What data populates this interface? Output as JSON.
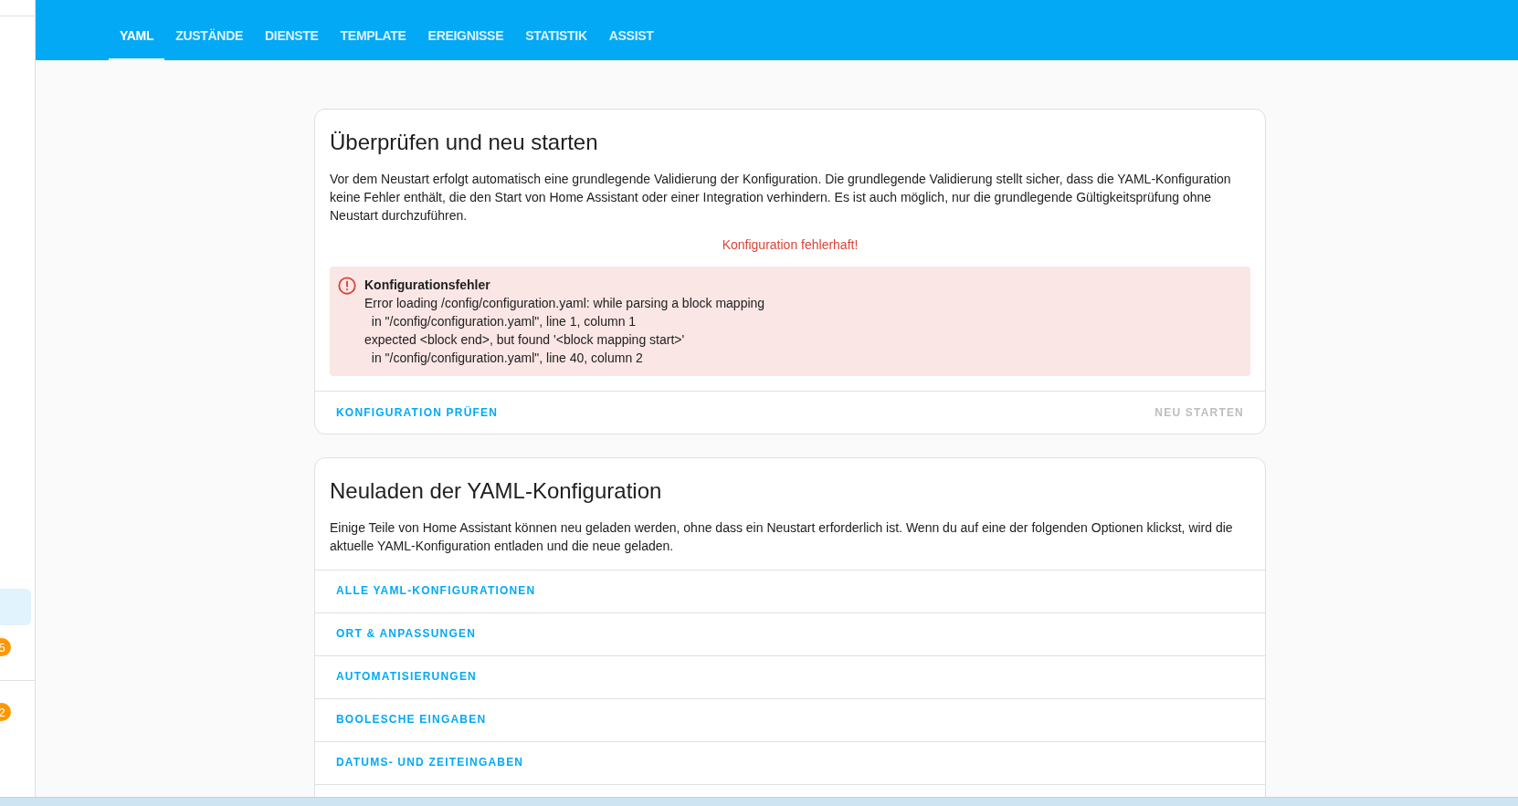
{
  "sidebar": {
    "items": [
      {
        "selected": true
      },
      {
        "selected": false,
        "badge": "5"
      },
      {
        "selected": false,
        "badge": "2"
      }
    ]
  },
  "tabs": [
    {
      "label": "YAML",
      "selected": true
    },
    {
      "label": "ZUSTÄNDE",
      "selected": false
    },
    {
      "label": "DIENSTE",
      "selected": false
    },
    {
      "label": "TEMPLATE",
      "selected": false
    },
    {
      "label": "EREIGNISSE",
      "selected": false
    },
    {
      "label": "STATISTIK",
      "selected": false
    },
    {
      "label": "ASSIST",
      "selected": false
    }
  ],
  "check_card": {
    "title": "Überprüfen und neu starten",
    "description": "Vor dem Neustart erfolgt automatisch eine grundlegende Validierung der Konfiguration. Die grundlegende Validierung stellt sicher, dass die YAML-Konfiguration keine Fehler enthält, die den Start von Home Assistant oder einer Integration verhindern. Es ist auch möglich, nur die grundlegende Gültigkeitsprüfung ohne Neustart durchzuführen.",
    "status": "Konfiguration fehlerhaft!",
    "error": {
      "title": "Konfigurationsfehler",
      "lines": [
        "Error loading /config/configuration.yaml: while parsing a block mapping",
        "  in \"/config/configuration.yaml\", line 1, column 1",
        "expected <block end>, but found '<block mapping start>'",
        "  in \"/config/configuration.yaml\", line 40, column 2"
      ]
    },
    "actions": [
      {
        "label": "KONFIGURATION PRÜFEN",
        "disabled": false
      },
      {
        "label": "NEU STARTEN",
        "disabled": true
      }
    ]
  },
  "reload_card": {
    "title": "Neuladen der YAML-Konfiguration",
    "description": "Einige Teile von Home Assistant können neu geladen werden, ohne dass ein Neustart erforderlich ist. Wenn du auf eine der folgenden Optionen klickst, wird die aktuelle YAML-Konfiguration entladen und die neue geladen.",
    "items": [
      "ALLE YAML-KONFIGURATIONEN",
      "ORT & ANPASSUNGEN",
      "AUTOMATISIERUNGEN",
      "BOOLESCHE EINGABEN",
      "DATUMS- UND ZEITEINGABEN"
    ]
  }
}
